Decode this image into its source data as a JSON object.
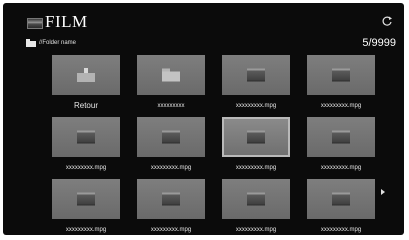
{
  "header": {
    "title": "FILM",
    "logo_icon": "film-logo-icon",
    "refresh_icon": "refresh-icon"
  },
  "path": {
    "icon": "folder-icon",
    "text": "//Folder name"
  },
  "page_counter": "5/9999",
  "items": [
    {
      "label": "Retour",
      "type": "back"
    },
    {
      "label": "xxxxxxxxx",
      "type": "folder"
    },
    {
      "label": "xxxxxxxxx.mpg",
      "type": "video"
    },
    {
      "label": "xxxxxxxxx.mpg",
      "type": "video"
    },
    {
      "label": "xxxxxxxxx.mpg",
      "type": "video"
    },
    {
      "label": "xxxxxxxxx.mpg",
      "type": "video"
    },
    {
      "label": "xxxxxxxxx.mpg",
      "type": "video",
      "selected": true
    },
    {
      "label": "xxxxxxxxx.mpg",
      "type": "video"
    },
    {
      "label": "xxxxxxxxx.mpg",
      "type": "video"
    },
    {
      "label": "xxxxxxxxx.mpg",
      "type": "video"
    },
    {
      "label": "xxxxxxxxx.mpg",
      "type": "video"
    },
    {
      "label": "xxxxxxxxx.mpg",
      "type": "video"
    }
  ],
  "next_page_icon": "chevron-right-icon"
}
